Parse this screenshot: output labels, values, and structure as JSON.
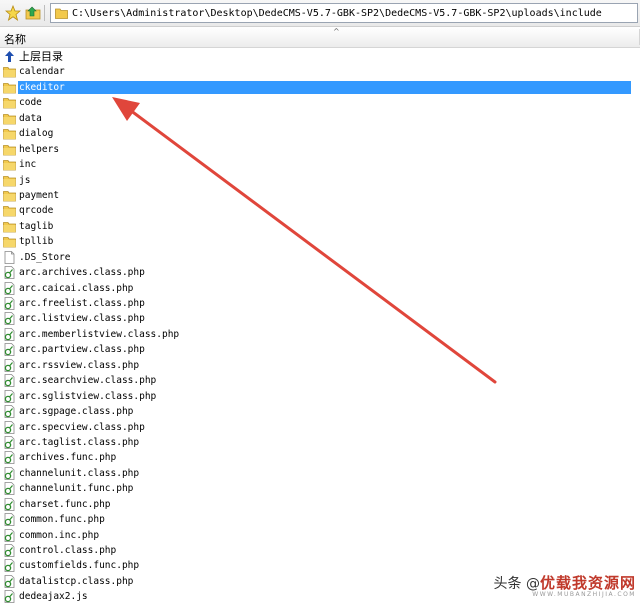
{
  "address_bar": {
    "path": "C:\\Users\\Administrator\\Desktop\\DedeCMS-V5.7-GBK-SP2\\DedeCMS-V5.7-GBK-SP2\\uploads\\include"
  },
  "column": {
    "name": "名称"
  },
  "files": [
    {
      "label": "上层目录",
      "type": "up"
    },
    {
      "label": "calendar",
      "type": "folder"
    },
    {
      "label": "ckeditor",
      "type": "folder",
      "selected": true
    },
    {
      "label": "code",
      "type": "folder"
    },
    {
      "label": "data",
      "type": "folder"
    },
    {
      "label": "dialog",
      "type": "folder"
    },
    {
      "label": "helpers",
      "type": "folder"
    },
    {
      "label": "inc",
      "type": "folder"
    },
    {
      "label": "js",
      "type": "folder"
    },
    {
      "label": "payment",
      "type": "folder"
    },
    {
      "label": "qrcode",
      "type": "folder"
    },
    {
      "label": "taglib",
      "type": "folder"
    },
    {
      "label": "tpllib",
      "type": "folder"
    },
    {
      "label": ".DS_Store",
      "type": "blank"
    },
    {
      "label": "arc.archives.class.php",
      "type": "php"
    },
    {
      "label": "arc.caicai.class.php",
      "type": "php"
    },
    {
      "label": "arc.freelist.class.php",
      "type": "php"
    },
    {
      "label": "arc.listview.class.php",
      "type": "php"
    },
    {
      "label": "arc.memberlistview.class.php",
      "type": "php"
    },
    {
      "label": "arc.partview.class.php",
      "type": "php"
    },
    {
      "label": "arc.rssview.class.php",
      "type": "php"
    },
    {
      "label": "arc.searchview.class.php",
      "type": "php"
    },
    {
      "label": "arc.sglistview.class.php",
      "type": "php"
    },
    {
      "label": "arc.sgpage.class.php",
      "type": "php"
    },
    {
      "label": "arc.specview.class.php",
      "type": "php"
    },
    {
      "label": "arc.taglist.class.php",
      "type": "php"
    },
    {
      "label": "archives.func.php",
      "type": "php"
    },
    {
      "label": "channelunit.class.php",
      "type": "php"
    },
    {
      "label": "channelunit.func.php",
      "type": "php"
    },
    {
      "label": "charset.func.php",
      "type": "php"
    },
    {
      "label": "common.func.php",
      "type": "php"
    },
    {
      "label": "common.inc.php",
      "type": "php"
    },
    {
      "label": "control.class.php",
      "type": "php"
    },
    {
      "label": "customfields.func.php",
      "type": "php"
    },
    {
      "label": "datalistcp.class.php",
      "type": "php"
    },
    {
      "label": "dedeajax2.js",
      "type": "php"
    }
  ],
  "watermark": {
    "prefix": "头条 @",
    "brand": "优载我资源网",
    "domain": "WWW.MUBANZHIJIA.COM"
  },
  "colors": {
    "selection": "#3399ff",
    "folder": "#f2c94c",
    "arrow": "#e0463b"
  }
}
